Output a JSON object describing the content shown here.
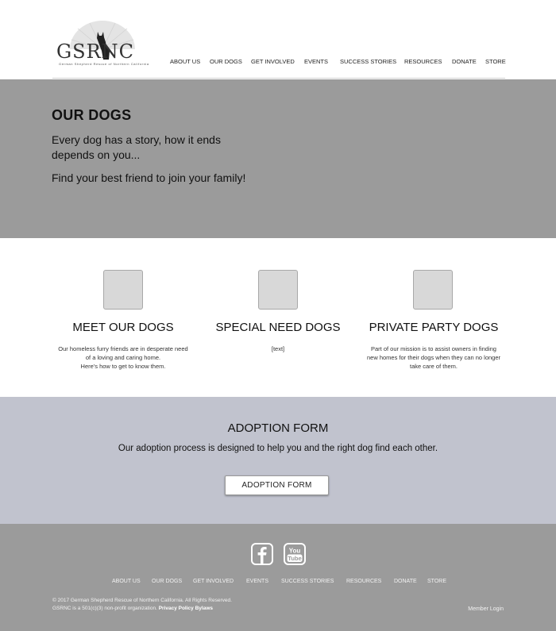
{
  "header": {
    "logo_text": "GSRNC",
    "logo_subtitle": "German Shepherd Rescue of Northern California",
    "nav": [
      "ABOUT US",
      "OUR DOGS",
      "GET INVOLVED",
      "EVENTS",
      "SUCCESS STORIES",
      "RESOURCES",
      "DONATE",
      "STORE"
    ]
  },
  "hero": {
    "title": "OUR DOGS",
    "line1": "Every dog has a story, how it ends",
    "line2": "depends on you...",
    "line3": "Find your best friend to join your family!"
  },
  "features": [
    {
      "title": "MEET OUR DOGS",
      "text": [
        "Our homeless furry friends are in desperate need",
        "of a loving and caring home.",
        "Here's how to get to know them."
      ]
    },
    {
      "title": "SPECIAL NEED DOGS",
      "text": [
        "[text]"
      ]
    },
    {
      "title": "PRIVATE PARTY DOGS",
      "text": [
        "Part of our mission is to assist owners in finding",
        "new homes for their dogs when they can no longer",
        "take care of them."
      ]
    }
  ],
  "adoption": {
    "title": "ADOPTION FORM",
    "text": "Our adoption process is designed to help you and the right dog find each other.",
    "button_label": "ADOPTION FORM"
  },
  "footer": {
    "social": [
      "facebook-icon",
      "youtube-icon"
    ],
    "youtube_top": "You",
    "youtube_bottom": "Tube",
    "nav": [
      "ABOUT US",
      "OUR DOGS",
      "GET INVOLVED",
      "EVENTS",
      "SUCCESS STORIES",
      "RESOURCES",
      "DONATE",
      "STORE"
    ],
    "copyright": "©  2017 German Shepherd Rescue of Northern California. All Rights Reserved.",
    "legal_prefix": "GSRNC is a 501(c)(3) non-profit organization.",
    "privacy_label": "Privacy Policy",
    "bylaws_label": "Bylaws",
    "member_login": "Member Login"
  },
  "colors": {
    "hero_bg": "#9b9b9b",
    "adoption_bg": "#c1c3ce",
    "footer_bg": "#9b9b9b",
    "placeholder_bg": "#d8d8d8"
  }
}
